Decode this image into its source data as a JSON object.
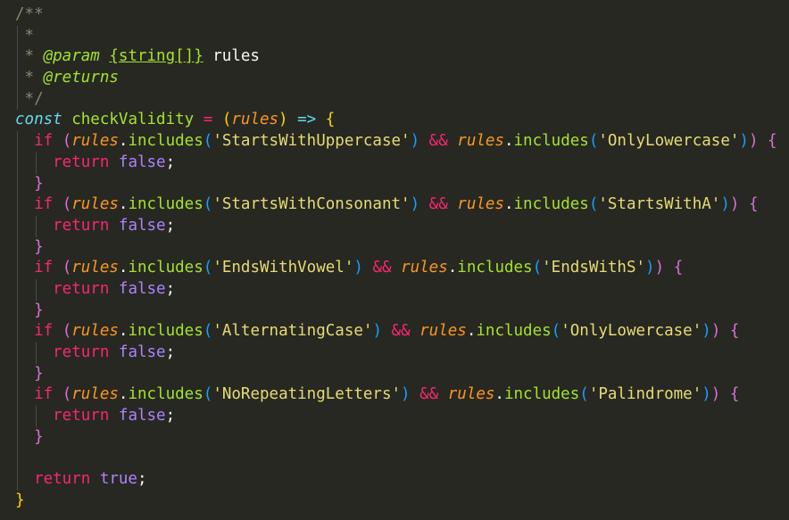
{
  "editor": {
    "lines": [
      {
        "guides": [],
        "tokens": [
          {
            "t": "/**",
            "c": "c-comment"
          }
        ]
      },
      {
        "guides": [
          1
        ],
        "tokens": [
          {
            "t": " *",
            "c": "c-comment"
          }
        ]
      },
      {
        "guides": [
          1
        ],
        "tokens": [
          {
            "t": " * ",
            "c": "c-comment"
          },
          {
            "t": "@param",
            "c": "c-doctag"
          },
          {
            "t": " ",
            "c": "c-comment"
          },
          {
            "t": "{string[]}",
            "c": "c-type"
          },
          {
            "t": " rules",
            "c": "c-plain"
          }
        ]
      },
      {
        "guides": [
          1
        ],
        "tokens": [
          {
            "t": " * ",
            "c": "c-comment"
          },
          {
            "t": "@returns",
            "c": "c-doctag"
          }
        ]
      },
      {
        "guides": [
          1
        ],
        "tokens": [
          {
            "t": " */",
            "c": "c-comment"
          }
        ]
      },
      {
        "guides": [],
        "tokens": [
          {
            "t": "const",
            "c": "c-kw"
          },
          {
            "t": " ",
            "c": "c-plain"
          },
          {
            "t": "checkValidity",
            "c": "c-fn"
          },
          {
            "t": " = ",
            "c": "c-op"
          },
          {
            "t": "(",
            "c": "b-y"
          },
          {
            "t": "rules",
            "c": "c-param"
          },
          {
            "t": ")",
            "c": "b-y"
          },
          {
            "t": " => ",
            "c": "c-kw"
          },
          {
            "t": "{",
            "c": "b-y"
          }
        ]
      },
      {
        "guides": [
          1
        ],
        "tokens": [
          {
            "t": "  if ",
            "c": "c-ret"
          },
          {
            "t": "(",
            "c": "b-m"
          },
          {
            "t": "rules",
            "c": "c-param"
          },
          {
            "t": ".",
            "c": "c-plain"
          },
          {
            "t": "includes",
            "c": "c-fn"
          },
          {
            "t": "(",
            "c": "b-b"
          },
          {
            "t": "'StartsWithUppercase'",
            "c": "c-str"
          },
          {
            "t": ")",
            "c": "b-b"
          },
          {
            "t": " && ",
            "c": "c-op"
          },
          {
            "t": "rules",
            "c": "c-param"
          },
          {
            "t": ".",
            "c": "c-plain"
          },
          {
            "t": "includes",
            "c": "c-fn"
          },
          {
            "t": "(",
            "c": "b-b"
          },
          {
            "t": "'OnlyLowercase'",
            "c": "c-str"
          },
          {
            "t": ")",
            "c": "b-b"
          },
          {
            "t": ")",
            "c": "b-m"
          },
          {
            "t": " ",
            "c": "c-plain"
          },
          {
            "t": "{",
            "c": "b-m"
          }
        ]
      },
      {
        "guides": [
          1,
          3
        ],
        "tokens": [
          {
            "t": "    return ",
            "c": "c-ret"
          },
          {
            "t": "false",
            "c": "c-bool"
          },
          {
            "t": ";",
            "c": "c-plain"
          }
        ]
      },
      {
        "guides": [
          1
        ],
        "tokens": [
          {
            "t": "  }",
            "c": "b-m"
          }
        ]
      },
      {
        "guides": [
          1
        ],
        "tokens": [
          {
            "t": "  if ",
            "c": "c-ret"
          },
          {
            "t": "(",
            "c": "b-m"
          },
          {
            "t": "rules",
            "c": "c-param"
          },
          {
            "t": ".",
            "c": "c-plain"
          },
          {
            "t": "includes",
            "c": "c-fn"
          },
          {
            "t": "(",
            "c": "b-b"
          },
          {
            "t": "'StartsWithConsonant'",
            "c": "c-str"
          },
          {
            "t": ")",
            "c": "b-b"
          },
          {
            "t": " && ",
            "c": "c-op"
          },
          {
            "t": "rules",
            "c": "c-param"
          },
          {
            "t": ".",
            "c": "c-plain"
          },
          {
            "t": "includes",
            "c": "c-fn"
          },
          {
            "t": "(",
            "c": "b-b"
          },
          {
            "t": "'StartsWithA'",
            "c": "c-str"
          },
          {
            "t": ")",
            "c": "b-b"
          },
          {
            "t": ")",
            "c": "b-m"
          },
          {
            "t": " ",
            "c": "c-plain"
          },
          {
            "t": "{",
            "c": "b-m"
          }
        ]
      },
      {
        "guides": [
          1,
          3
        ],
        "tokens": [
          {
            "t": "    return ",
            "c": "c-ret"
          },
          {
            "t": "false",
            "c": "c-bool"
          },
          {
            "t": ";",
            "c": "c-plain"
          }
        ]
      },
      {
        "guides": [
          1
        ],
        "tokens": [
          {
            "t": "  }",
            "c": "b-m"
          }
        ]
      },
      {
        "guides": [
          1
        ],
        "tokens": [
          {
            "t": "  if ",
            "c": "c-ret"
          },
          {
            "t": "(",
            "c": "b-m"
          },
          {
            "t": "rules",
            "c": "c-param"
          },
          {
            "t": ".",
            "c": "c-plain"
          },
          {
            "t": "includes",
            "c": "c-fn"
          },
          {
            "t": "(",
            "c": "b-b"
          },
          {
            "t": "'EndsWithVowel'",
            "c": "c-str"
          },
          {
            "t": ")",
            "c": "b-b"
          },
          {
            "t": " && ",
            "c": "c-op"
          },
          {
            "t": "rules",
            "c": "c-param"
          },
          {
            "t": ".",
            "c": "c-plain"
          },
          {
            "t": "includes",
            "c": "c-fn"
          },
          {
            "t": "(",
            "c": "b-b"
          },
          {
            "t": "'EndsWithS'",
            "c": "c-str"
          },
          {
            "t": ")",
            "c": "b-b"
          },
          {
            "t": ")",
            "c": "b-m"
          },
          {
            "t": " ",
            "c": "c-plain"
          },
          {
            "t": "{",
            "c": "b-m"
          }
        ]
      },
      {
        "guides": [
          1,
          3
        ],
        "tokens": [
          {
            "t": "    return ",
            "c": "c-ret"
          },
          {
            "t": "false",
            "c": "c-bool"
          },
          {
            "t": ";",
            "c": "c-plain"
          }
        ]
      },
      {
        "guides": [
          1
        ],
        "tokens": [
          {
            "t": "  }",
            "c": "b-m"
          }
        ]
      },
      {
        "guides": [
          1
        ],
        "tokens": [
          {
            "t": "  if ",
            "c": "c-ret"
          },
          {
            "t": "(",
            "c": "b-m"
          },
          {
            "t": "rules",
            "c": "c-param"
          },
          {
            "t": ".",
            "c": "c-plain"
          },
          {
            "t": "includes",
            "c": "c-fn"
          },
          {
            "t": "(",
            "c": "b-b"
          },
          {
            "t": "'AlternatingCase'",
            "c": "c-str"
          },
          {
            "t": ")",
            "c": "b-b"
          },
          {
            "t": " && ",
            "c": "c-op"
          },
          {
            "t": "rules",
            "c": "c-param"
          },
          {
            "t": ".",
            "c": "c-plain"
          },
          {
            "t": "includes",
            "c": "c-fn"
          },
          {
            "t": "(",
            "c": "b-b"
          },
          {
            "t": "'OnlyLowercase'",
            "c": "c-str"
          },
          {
            "t": ")",
            "c": "b-b"
          },
          {
            "t": ")",
            "c": "b-m"
          },
          {
            "t": " ",
            "c": "c-plain"
          },
          {
            "t": "{",
            "c": "b-m"
          }
        ]
      },
      {
        "guides": [
          1,
          3
        ],
        "tokens": [
          {
            "t": "    return ",
            "c": "c-ret"
          },
          {
            "t": "false",
            "c": "c-bool"
          },
          {
            "t": ";",
            "c": "c-plain"
          }
        ]
      },
      {
        "guides": [
          1
        ],
        "tokens": [
          {
            "t": "  }",
            "c": "b-m"
          }
        ]
      },
      {
        "guides": [
          1
        ],
        "tokens": [
          {
            "t": "  if ",
            "c": "c-ret"
          },
          {
            "t": "(",
            "c": "b-m"
          },
          {
            "t": "rules",
            "c": "c-param"
          },
          {
            "t": ".",
            "c": "c-plain"
          },
          {
            "t": "includes",
            "c": "c-fn"
          },
          {
            "t": "(",
            "c": "b-b"
          },
          {
            "t": "'NoRepeatingLetters'",
            "c": "c-str"
          },
          {
            "t": ")",
            "c": "b-b"
          },
          {
            "t": " && ",
            "c": "c-op"
          },
          {
            "t": "rules",
            "c": "c-param"
          },
          {
            "t": ".",
            "c": "c-plain"
          },
          {
            "t": "includes",
            "c": "c-fn"
          },
          {
            "t": "(",
            "c": "b-b"
          },
          {
            "t": "'Palindrome'",
            "c": "c-str"
          },
          {
            "t": ")",
            "c": "b-b"
          },
          {
            "t": ")",
            "c": "b-m"
          },
          {
            "t": " ",
            "c": "c-plain"
          },
          {
            "t": "{",
            "c": "b-m"
          }
        ]
      },
      {
        "guides": [
          1,
          3
        ],
        "tokens": [
          {
            "t": "    return ",
            "c": "c-ret"
          },
          {
            "t": "false",
            "c": "c-bool"
          },
          {
            "t": ";",
            "c": "c-plain"
          }
        ]
      },
      {
        "guides": [
          1
        ],
        "tokens": [
          {
            "t": "  }",
            "c": "b-m"
          }
        ]
      },
      {
        "guides": [
          1
        ],
        "tokens": []
      },
      {
        "guides": [
          1
        ],
        "tokens": [
          {
            "t": "  return ",
            "c": "c-ret"
          },
          {
            "t": "true",
            "c": "c-bool"
          },
          {
            "t": ";",
            "c": "c-plain"
          }
        ]
      },
      {
        "guides": [],
        "tokens": [
          {
            "t": "}",
            "c": "b-y"
          }
        ]
      }
    ]
  }
}
